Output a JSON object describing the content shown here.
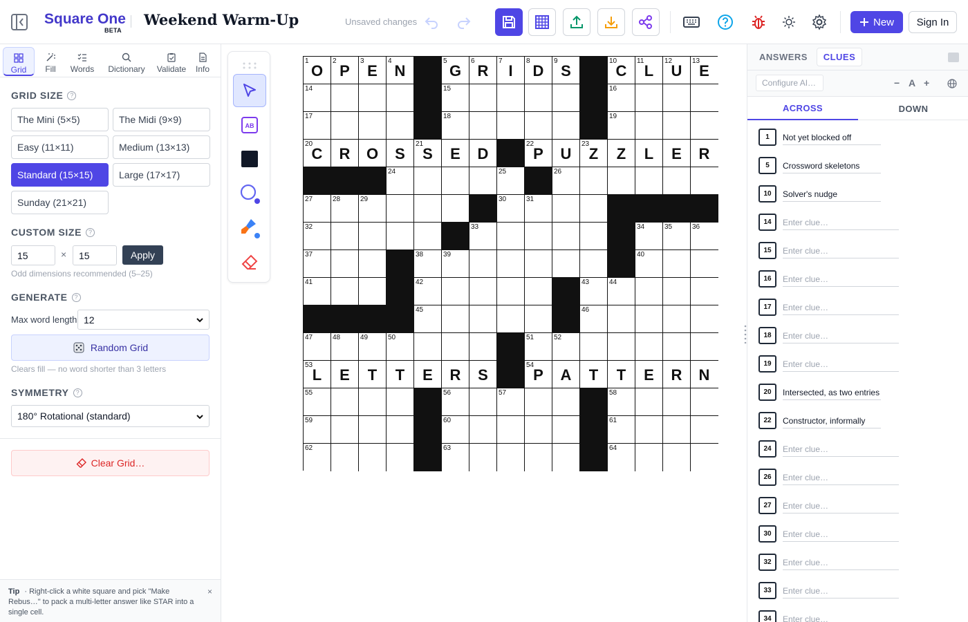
{
  "header": {
    "brand_name": "Square One",
    "brand_badge": "BETA",
    "puzzle_title": "Weekend Warm-Up",
    "status": "Unsaved changes",
    "new_label": "New",
    "signin_label": "Sign In",
    "accent_color": "#4f46e5"
  },
  "left_panel": {
    "tabs": [
      {
        "label": "Grid",
        "icon": "grid-icon"
      },
      {
        "label": "Fill",
        "icon": "wand-icon"
      },
      {
        "label": "Words",
        "icon": "list-check-icon"
      },
      {
        "label": "Dictionary",
        "icon": "search-icon"
      },
      {
        "label": "Validate",
        "icon": "clipboard-check-icon"
      },
      {
        "label": "Info",
        "icon": "document-icon"
      }
    ],
    "grid_size": {
      "title": "GRID SIZE",
      "options": [
        "The Mini (5×5)",
        "The Midi (9×9)",
        "Easy (11×11)",
        "Medium (13×13)",
        "Standard (15×15)",
        "Large (17×17)",
        "Sunday (21×21)"
      ],
      "selected": "Standard (15×15)"
    },
    "custom_size": {
      "title": "CUSTOM SIZE",
      "width": "15",
      "separator": "×",
      "height": "15",
      "apply_label": "Apply",
      "hint": "Odd dimensions recommended (5–25)"
    },
    "generate": {
      "title": "GENERATE",
      "max_word_label": "Max word length",
      "max_word_value": "12",
      "random_label": "Random Grid",
      "hint": "Clears fill — no word shorter than 3 letters"
    },
    "symmetry": {
      "title": "SYMMETRY",
      "value": "180° Rotational (standard)"
    },
    "clear_label": "Clear Grid…",
    "tip": {
      "label": "Tip",
      "text": "· Right-click a white square and pick \"Make Rebus…\" to pack a multi-letter answer like STAR into a single cell.",
      "close": "×"
    }
  },
  "tools": [
    "select-tool",
    "rebus-tool",
    "block-tool",
    "circle-tool",
    "shade-tool",
    "eraser-tool"
  ],
  "grid": {
    "rows": [
      "OPEN#GRIDS#CLUE",
      "....#.....#....",
      "....#.....#....",
      "CROSSED#PUZZLER",
      "###.....#......",
      "......#....####",
      ".....#.....#...",
      "...#.......#...",
      "...#.....#.....",
      "####.....#.....",
      "......#......##",
      "....##.........",
      "LETTERS#PATTERN"
    ],
    "rows_full": [
      "OPEN#GRIDS#CLUE",
      "....#.....#....",
      "....#.....#....",
      "CROSSED#PUZZLER",
      "###.....#......",
      "......#....####",
      ".....#.....#...",
      "...#.......#...",
      "...#.....#.....",
      "####.....#.....",
      ".......#.......",
      "LETTERS#PATTERN",
      "....#.....#....",
      "....#.....#....",
      "....#.....#...."
    ]
  },
  "right_panel": {
    "tabs": [
      "ANSWERS",
      "CLUES"
    ],
    "active_tab": "CLUES",
    "ai_placeholder": "Configure AI…",
    "font_controls": [
      "−",
      "A",
      "+"
    ],
    "direction_tabs": [
      "ACROSS",
      "DOWN"
    ],
    "active_direction": "ACROSS",
    "clue_placeholder": "Enter clue…",
    "across_clues": [
      {
        "num": "1",
        "text": "Not yet blocked off"
      },
      {
        "num": "5",
        "text": "Crossword skeletons"
      },
      {
        "num": "10",
        "text": "Solver's nudge"
      },
      {
        "num": "14",
        "text": ""
      },
      {
        "num": "15",
        "text": ""
      },
      {
        "num": "16",
        "text": ""
      },
      {
        "num": "17",
        "text": ""
      },
      {
        "num": "18",
        "text": ""
      },
      {
        "num": "19",
        "text": ""
      },
      {
        "num": "20",
        "text": "Intersected, as two entries"
      },
      {
        "num": "22",
        "text": "Constructor, informally"
      },
      {
        "num": "24",
        "text": ""
      },
      {
        "num": "26",
        "text": ""
      },
      {
        "num": "27",
        "text": ""
      },
      {
        "num": "30",
        "text": ""
      },
      {
        "num": "32",
        "text": ""
      },
      {
        "num": "33",
        "text": ""
      },
      {
        "num": "34",
        "text": ""
      }
    ]
  }
}
